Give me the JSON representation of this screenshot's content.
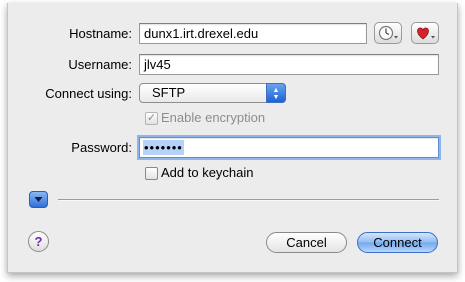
{
  "form": {
    "hostname": {
      "label": "Hostname:",
      "value": "dunx1.irt.drexel.edu"
    },
    "username": {
      "label": "Username:",
      "value": "jlv45"
    },
    "connect_using": {
      "label": "Connect using:",
      "value": "SFTP"
    },
    "encryption": {
      "label": "Enable encryption",
      "checked": true,
      "enabled": false,
      "mark": "✓"
    },
    "password": {
      "label": "Password:",
      "value_masked": "•••••••"
    },
    "keychain": {
      "label": "Add to keychain",
      "checked": false
    }
  },
  "buttons": {
    "cancel": "Cancel",
    "connect": "Connect",
    "help": "?"
  },
  "icons": {
    "history": "clock-icon",
    "favorites": "heart-icon",
    "options": "disclosure-triangle-icon",
    "popup": "up-down-arrows-icon"
  },
  "colors": {
    "accent": "#2e6fd8",
    "heart": "#d4222c",
    "help": "#6a2fa8"
  }
}
